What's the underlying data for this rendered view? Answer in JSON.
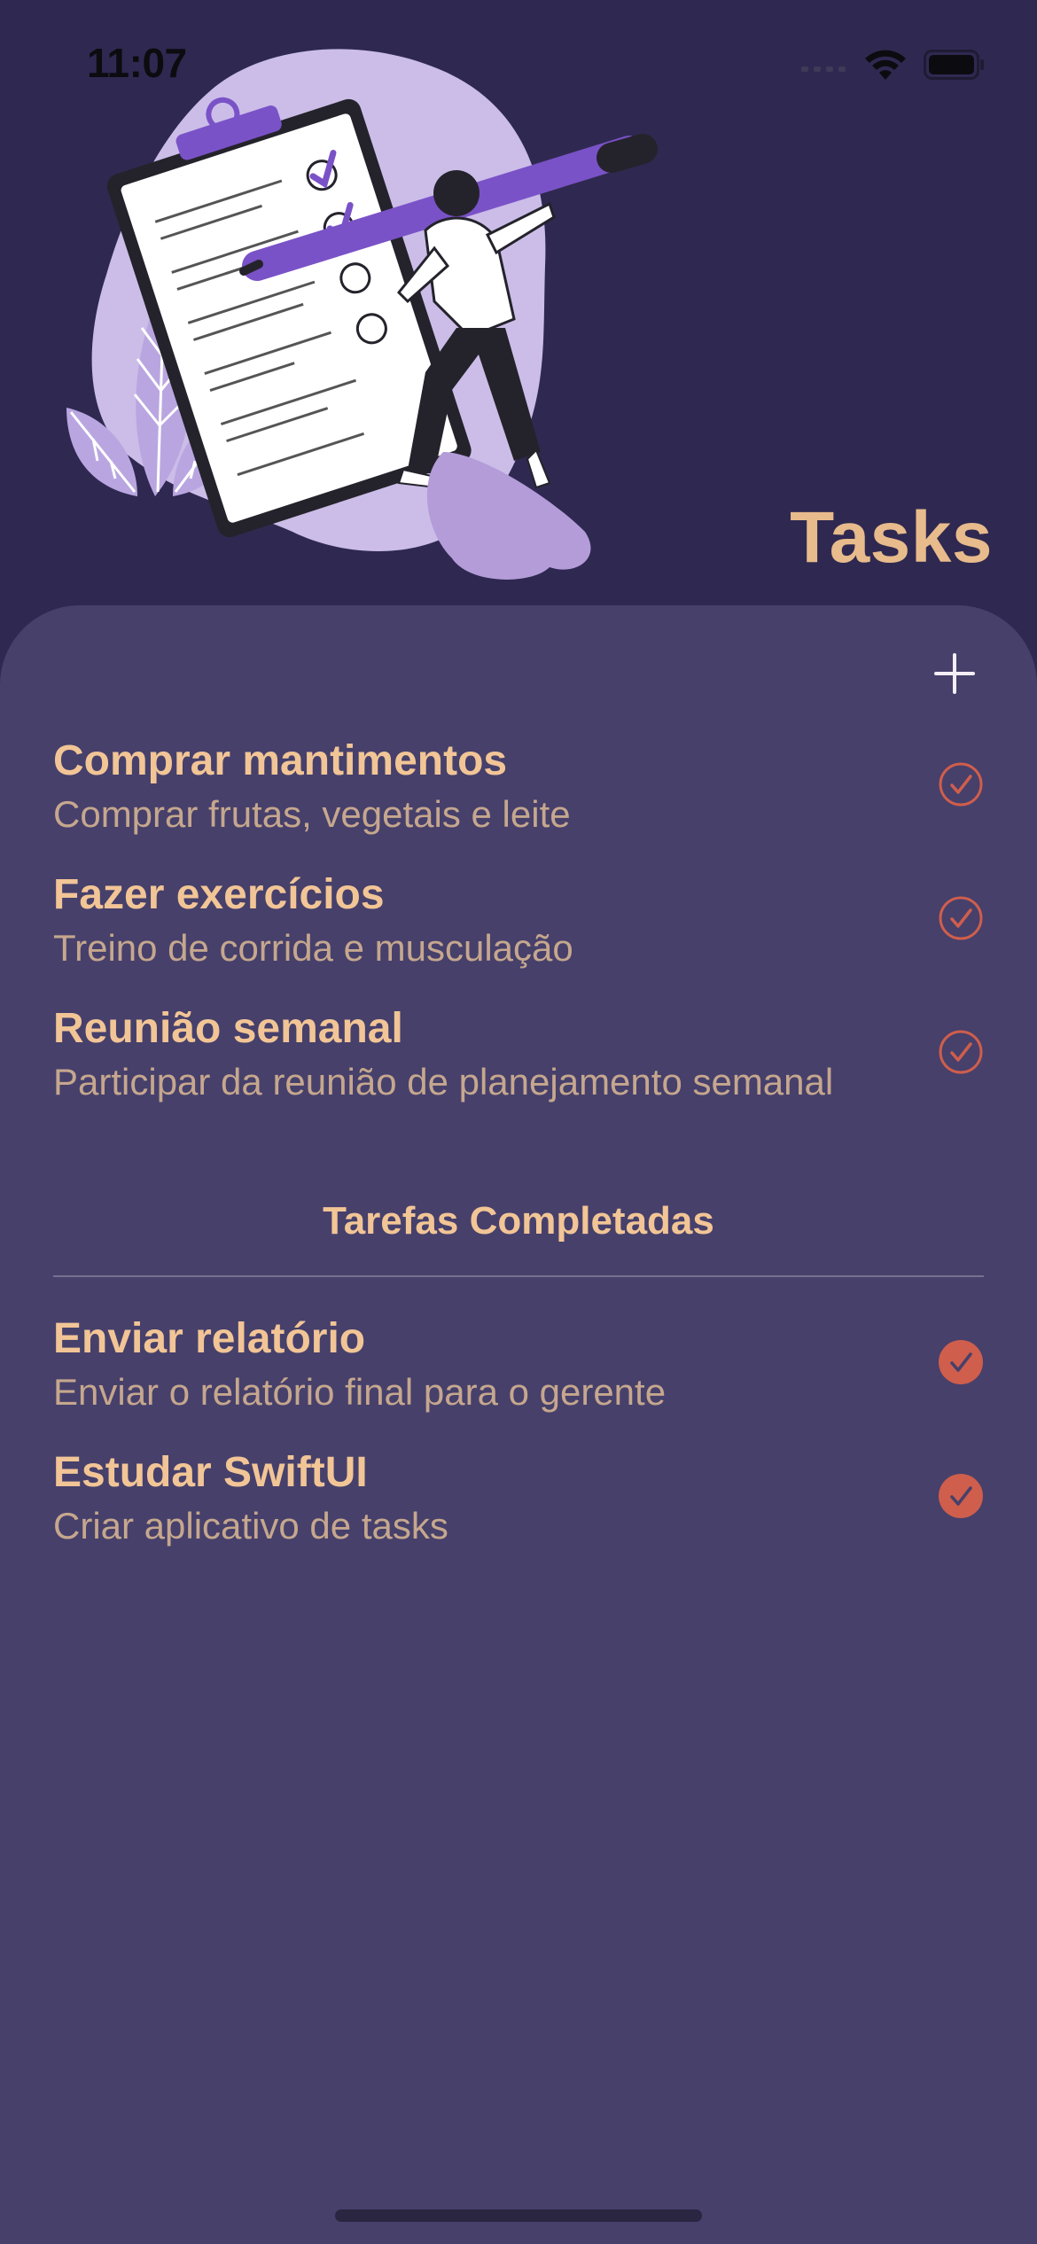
{
  "status_bar": {
    "time": "11:07"
  },
  "header": {
    "title": "Tasks"
  },
  "colors": {
    "background_top": "#2f2951",
    "sheet": "#46406b",
    "accent_text": "#f2c596",
    "subtitle_text": "#c6a78e",
    "check": "#cf5e4c"
  },
  "icons": {
    "add": "plus-icon",
    "pending": "circle-check-outline-icon",
    "completed": "circle-check-filled-icon"
  },
  "tasks": [
    {
      "title": "Comprar mantimentos",
      "description": "Comprar frutas, vegetais e leite"
    },
    {
      "title": "Fazer exercícios",
      "description": "Treino de corrida e musculação"
    },
    {
      "title": "Reunião semanal",
      "description": "Participar da reunião de planejamento semanal"
    }
  ],
  "completed_section": {
    "title": "Tarefas Completadas",
    "tasks": [
      {
        "title": "Enviar relatório",
        "description": "Enviar o relatório final para o gerente"
      },
      {
        "title": "Estudar SwiftUI",
        "description": "Criar aplicativo de tasks"
      }
    ]
  }
}
